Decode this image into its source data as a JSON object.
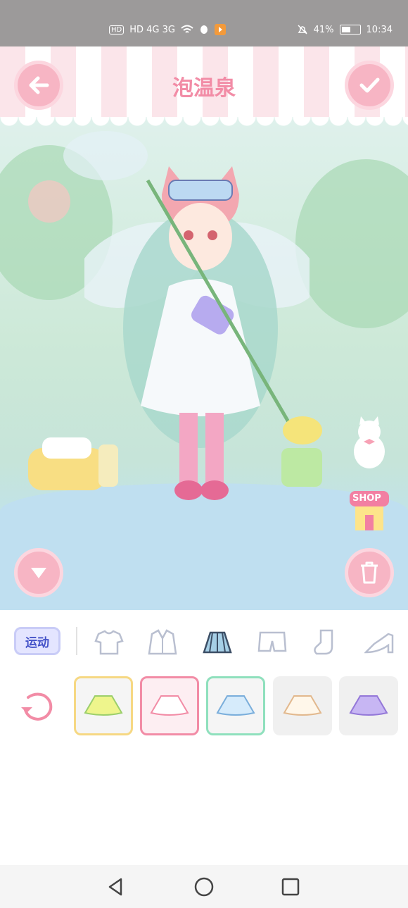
{
  "status": {
    "network": "HD 4G 3G",
    "battery_pct": "41%",
    "time": "10:34"
  },
  "header": {
    "title": "泡温泉"
  },
  "categories": {
    "active_label": "运动"
  },
  "colors": {
    "accent": "#f28ca6",
    "header_stripe": "#fbe5ea",
    "category_active": "#4452c8"
  },
  "icons": {
    "back": "arrow-left-icon",
    "confirm": "check-icon",
    "collapse": "chevron-down-icon",
    "delete": "trash-icon",
    "reset": "refresh-icon",
    "shop": "SHOP"
  },
  "category_icons": [
    "tshirt-icon",
    "jacket-icon",
    "skirt-icon",
    "shorts-icon",
    "sock-icon",
    "heel-icon"
  ],
  "items": [
    "yellow-skirt",
    "white-pink-skirt",
    "blue-skirt",
    "cream-skirt",
    "purple-skirt"
  ]
}
